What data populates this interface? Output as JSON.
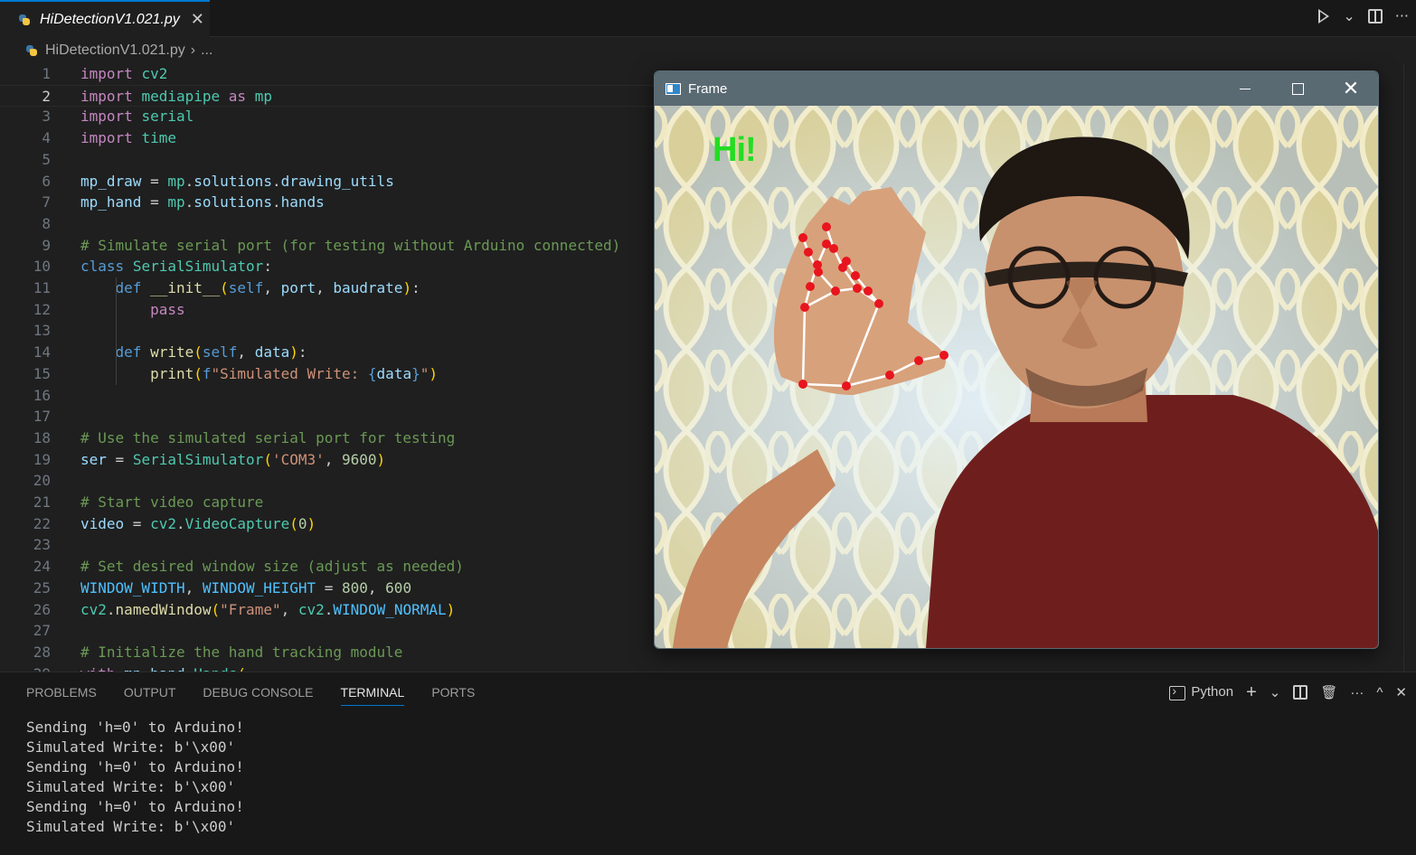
{
  "editor_tab": {
    "title": "HiDetectionV1.021.py",
    "close": "✕"
  },
  "top_actions": {
    "more": "···",
    "dropdown": "⌄"
  },
  "breadcrumb": {
    "file": "HiDetectionV1.021.py",
    "sep": "›",
    "more": "..."
  },
  "code": {
    "current_line": 2,
    "lines": [
      "import cv2",
      "import mediapipe as mp",
      "import serial",
      "import time",
      "",
      "mp_draw = mp.solutions.drawing_utils",
      "mp_hand = mp.solutions.hands",
      "",
      "# Simulate serial port (for testing without Arduino connected)",
      "class SerialSimulator:",
      "    def __init__(self, port, baudrate):",
      "        pass",
      "",
      "    def write(self, data):",
      "        print(f\"Simulated Write: {data}\")",
      "",
      "",
      "# Use the simulated serial port for testing",
      "ser = SerialSimulator('COM3', 9600)",
      "",
      "# Start video capture",
      "video = cv2.VideoCapture(0)",
      "",
      "# Set desired window size (adjust as needed)",
      "WINDOW_WIDTH, WINDOW_HEIGHT = 800, 600",
      "cv2.namedWindow(\"Frame\", cv2.WINDOW_NORMAL)",
      "",
      "# Initialize the hand tracking module",
      "with mp_hand.Hands("
    ]
  },
  "panel": {
    "tabs": [
      "PROBLEMS",
      "OUTPUT",
      "DEBUG CONSOLE",
      "TERMINAL",
      "PORTS"
    ],
    "active_tab": "TERMINAL",
    "terminal_profile": "Python",
    "output": [
      "Sending 'h=0' to Arduino!",
      "Simulated Write: b'\\x00'",
      "Sending 'h=0' to Arduino!",
      "Simulated Write: b'\\x00'",
      "Sending 'h=0' to Arduino!",
      "Simulated Write: b'\\x00'"
    ],
    "actions": {
      "add": "+",
      "chevron": "⌄",
      "more": "···",
      "maximize": "^",
      "close": "✕"
    }
  },
  "frame_window": {
    "title": "Frame",
    "overlay_text": "Hi!",
    "overlay_color": "#22dd22",
    "landmark_color": "#e8141e",
    "connection_color": "#ffffff"
  }
}
